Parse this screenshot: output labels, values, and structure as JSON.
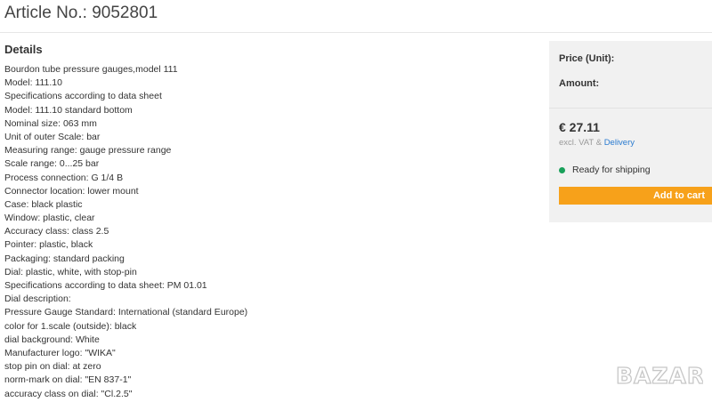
{
  "article": {
    "title": "Article No.: 9052801"
  },
  "details": {
    "heading": "Details",
    "lines": [
      "Bourdon tube pressure gauges,model 111",
      "Model: 111.10",
      "Specifications according to data sheet",
      "Model: 111.10 standard bottom",
      "Nominal size: 063 mm",
      "Unit of outer Scale: bar",
      "Measuring range: gauge pressure range",
      "Scale range: 0...25 bar",
      "Process connection: G 1/4 B",
      "Connector location: lower mount",
      "Case: black plastic",
      "Window: plastic, clear",
      "Accuracy class: class 2.5",
      "Pointer: plastic, black",
      "Packaging: standard packing",
      "Dial: plastic, white, with stop-pin",
      "Specifications according to data sheet: PM 01.01",
      "Dial description:",
      "Pressure Gauge Standard: International (standard Europe)",
      "color for 1.scale (outside): black",
      "dial background: White",
      "Manufacturer logo: \"WIKA\"",
      "stop pin on dial: at zero",
      "norm-mark on dial: \"EN 837-1\"",
      "accuracy class on dial: \"Cl.2.5\""
    ]
  },
  "price": {
    "unit_label": "Price (Unit):",
    "amount_label": "Amount:",
    "value": "€ 27.11",
    "note_prefix": "excl. VAT &",
    "delivery_link": "Delivery",
    "shipping_status": "Ready for shipping",
    "add_to_cart": "Add to cart",
    "colors": {
      "accent": "#f7a11a",
      "status": "#19a05a",
      "link": "#2a7bd0"
    }
  },
  "watermark": {
    "text": "BAZAR"
  }
}
